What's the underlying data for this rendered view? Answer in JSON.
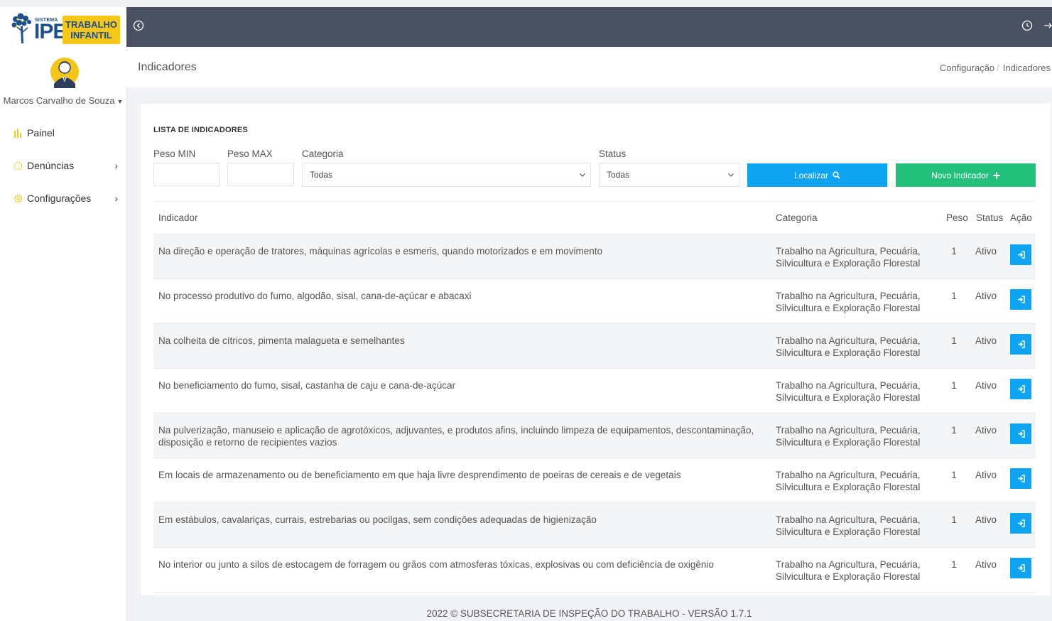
{
  "brand": {
    "sistema": "SISTEMA",
    "ipe": "IPE",
    "line1": "TRABALHO",
    "line2": "INFANTIL"
  },
  "user": {
    "name": "Marcos Carvalho de Souza"
  },
  "sidebar": {
    "items": [
      {
        "label": "Painel",
        "icon": "chart-icon",
        "has_children": false
      },
      {
        "label": "Denúncias",
        "icon": "bell-icon",
        "has_children": true
      },
      {
        "label": "Configurações",
        "icon": "gear-icon",
        "has_children": true
      }
    ]
  },
  "topbar": {
    "icons": [
      "back-icon",
      "clock-icon",
      "logout-icon"
    ]
  },
  "page": {
    "title": "Indicadores",
    "breadcrumb": [
      "Configuração",
      "Indicadores"
    ]
  },
  "list": {
    "title": "LISTA DE INDICADORES",
    "filters": {
      "peso_min_label": "Peso MIN",
      "peso_min_value": "",
      "peso_max_label": "Peso MAX",
      "peso_max_value": "",
      "categoria_label": "Categoria",
      "categoria_value": "Todas",
      "status_label": "Status",
      "status_value": "Todas"
    },
    "buttons": {
      "search": "Localizar",
      "new": "Novo Indicador"
    },
    "columns": {
      "indicador": "Indicador",
      "categoria": "Categoria",
      "peso": "Peso",
      "status": "Status",
      "acao": "Ação"
    },
    "rows": [
      {
        "indicador": "Na direção e operação de tratores, máquinas agrícolas e esmeris, quando motorizados e em movimento",
        "categoria": "Trabalho na Agricultura, Pecuária, Silvicultura e Exploração Florestal",
        "peso": "1",
        "status": "Ativo"
      },
      {
        "indicador": "No processo produtivo do fumo, algodão, sisal, cana-de-açúcar e abacaxi",
        "categoria": "Trabalho na Agricultura, Pecuária, Silvicultura e Exploração Florestal",
        "peso": "1",
        "status": "Ativo"
      },
      {
        "indicador": "Na colheita de cítricos, pimenta malagueta e semelhantes",
        "categoria": "Trabalho na Agricultura, Pecuária, Silvicultura e Exploração Florestal",
        "peso": "1",
        "status": "Ativo"
      },
      {
        "indicador": "No beneficiamento do fumo, sisal, castanha de caju e cana-de-açúcar",
        "categoria": "Trabalho na Agricultura, Pecuária, Silvicultura e Exploração Florestal",
        "peso": "1",
        "status": "Ativo"
      },
      {
        "indicador": "Na pulverização, manuseio e aplicação de agrotóxicos, adjuvantes, e produtos afins, incluindo limpeza de equipamentos, descontaminação, disposição e retorno de recipientes vazios",
        "categoria": "Trabalho na Agricultura, Pecuária, Silvicultura e Exploração Florestal",
        "peso": "1",
        "status": "Ativo"
      },
      {
        "indicador": "Em locais de armazenamento ou de beneficiamento em que haja livre desprendimento de poeiras de cereais e de vegetais",
        "categoria": "Trabalho na Agricultura, Pecuária, Silvicultura e Exploração Florestal",
        "peso": "1",
        "status": "Ativo"
      },
      {
        "indicador": "Em estábulos, cavalariças, currais, estrebarias ou pocilgas, sem condições adequadas de higienização",
        "categoria": "Trabalho na Agricultura, Pecuária, Silvicultura e Exploração Florestal",
        "peso": "1",
        "status": "Ativo"
      },
      {
        "indicador": "No interior ou junto a silos de estocagem de forragem ou grãos com atmosferas tóxicas, explosivas ou com deficiência de oxigênio",
        "categoria": "Trabalho na Agricultura, Pecuária, Silvicultura e Exploração Florestal",
        "peso": "1",
        "status": "Ativo"
      }
    ]
  },
  "footer": {
    "text": "2022 © SUBSECRETARIA DE INSPEÇÃO DO TRABALHO - VERSÃO 1.7.1"
  },
  "colors": {
    "topbar": "#4a5162",
    "primary_blue": "#0fa4f2",
    "success_green": "#22c07a",
    "brand_yellow": "#f6c619",
    "brand_navy": "#1b4f8e"
  }
}
